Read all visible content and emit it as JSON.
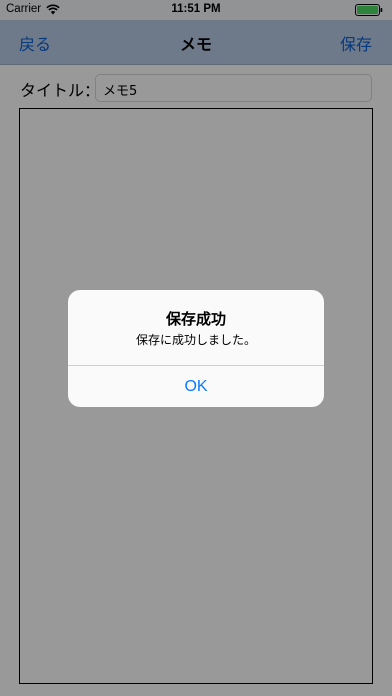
{
  "status_bar": {
    "carrier": "Carrier",
    "time": "11:51 PM",
    "battery_color": "#4cd964"
  },
  "nav": {
    "back_label": "戻る",
    "title": "メモ",
    "save_label": "保存"
  },
  "form": {
    "title_label": "タイトル：",
    "title_value": "メモ5",
    "memo_body": ""
  },
  "alert": {
    "title": "保存成功",
    "message": "保存に成功しました。",
    "ok_label": "OK"
  },
  "colors": {
    "accent": "#0a7aff",
    "nav_background": "#b7cbe7",
    "dim_overlay": "rgba(0,0,0,0.4)"
  },
  "icons": {
    "wifi": "wifi-icon",
    "battery": "battery-icon"
  }
}
